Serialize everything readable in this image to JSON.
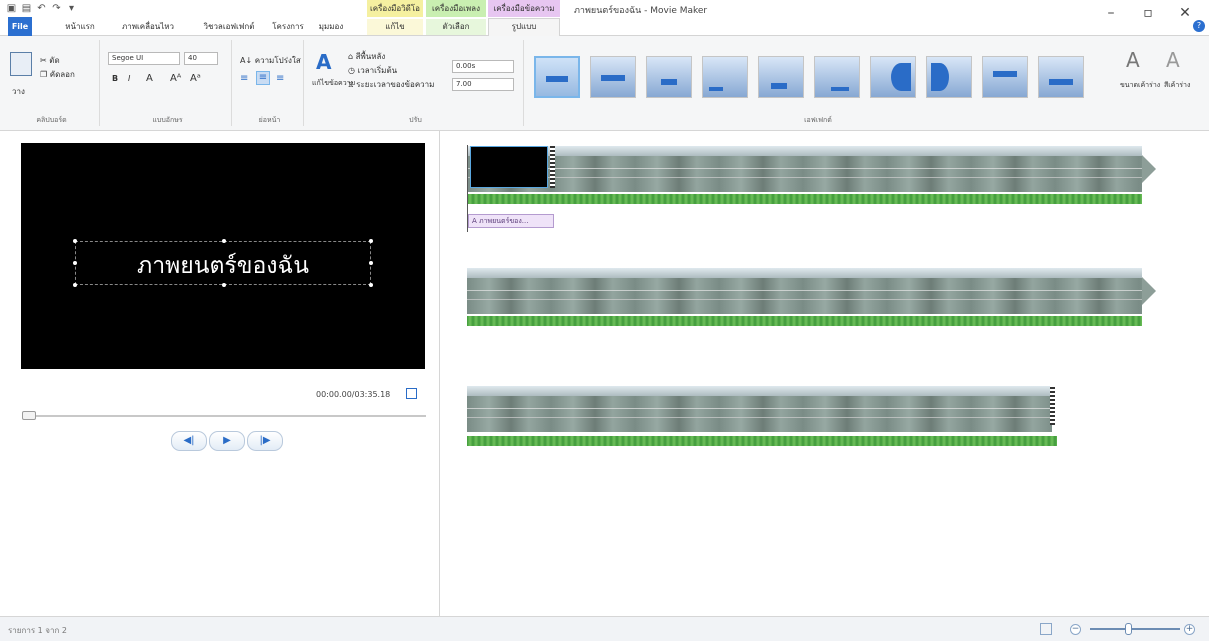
{
  "app": {
    "title": "ภาพยนตร์ของฉัน - Movie Maker"
  },
  "quick_access": [
    "save-icon",
    "undo-icon",
    "redo-icon",
    "customize-icon"
  ],
  "context_groups": [
    {
      "label": "เครื่องมือวิดีโอ",
      "color": "#f5f0a0"
    },
    {
      "label": "เครื่องมือเพลง",
      "color": "#c9efb1"
    },
    {
      "label": "เครื่องมือข้อความ",
      "color": "#e7c6f1"
    }
  ],
  "tabs": {
    "file": "File",
    "home": "หน้าแรก",
    "animations": "ภาพเคลื่อนไหว",
    "visual_effects": "วิชวลเอฟเฟกต์",
    "project": "โครงการ",
    "view": "มุมมอง",
    "ctx_edit_video": "แก้ไข",
    "ctx_options_music": "ตัวเลือก",
    "ctx_format": "รูปแบบ"
  },
  "ribbon": {
    "clipboard": {
      "paste": "วาง",
      "cut": "ตัด",
      "copy": "คัดลอก",
      "label": "คลิปบอร์ด"
    },
    "font": {
      "name": "Segoe UI",
      "size": "40",
      "bold": "B",
      "italic": "I",
      "label": "แบบอักษร"
    },
    "paragraph": {
      "transparency": "ความโปร่งใส",
      "label": "ย่อหน้า"
    },
    "adjust": {
      "edit_text": "แก้ไขข้อความ",
      "bg_color": "สีพื้นหลัง",
      "start_time": "เวลาเริ่มต้น",
      "start_time_value": "0.00s",
      "duration_label": "ระยะเวลาของข้อความ",
      "duration_value": "7.00",
      "label": "ปรับ"
    },
    "effects": {
      "label": "เอฟเฟกต์",
      "count": 10,
      "selected_index": 0
    },
    "outline": {
      "size": "ขนาดเค้าร่าง",
      "color": "สีเค้าร่าง"
    }
  },
  "preview": {
    "title_text": "ภาพยนตร์ของฉัน",
    "timecode": "00:00.00/03:35.18",
    "seek_progress": 0.0,
    "transport": {
      "prev": "◀|",
      "play": "▶",
      "next": "|▶"
    }
  },
  "storyboard": {
    "title_clip_label": "A ภาพยนตร์ของ..."
  },
  "status": {
    "text": "รายการ 1 จาก 2"
  }
}
